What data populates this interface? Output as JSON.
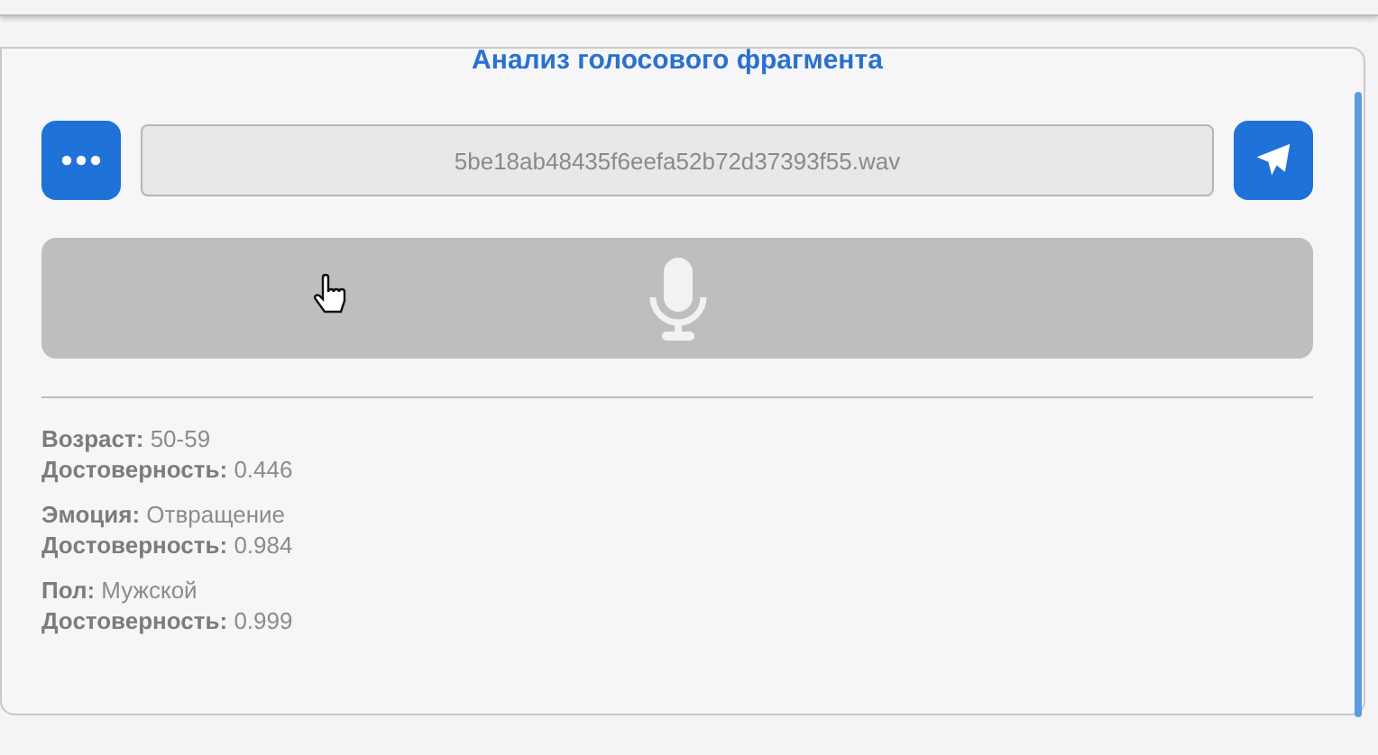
{
  "title": "Анализ голосового фрагмента",
  "file_field": {
    "value": "5be18ab48435f6eefa52b72d37393f55.wav"
  },
  "record_button": {
    "disabled": true
  },
  "results": [
    {
      "lines": [
        "**Возраст:** 50-59",
        "**Достоверность:** 0.446"
      ]
    },
    {
      "lines": [
        "**Эмоция:** Отвращение",
        "**Достоверность:** 0.984"
      ]
    },
    {
      "lines": [
        "**Пол:** Мужской",
        "**Достоверность:** 0.999"
      ]
    }
  ]
}
